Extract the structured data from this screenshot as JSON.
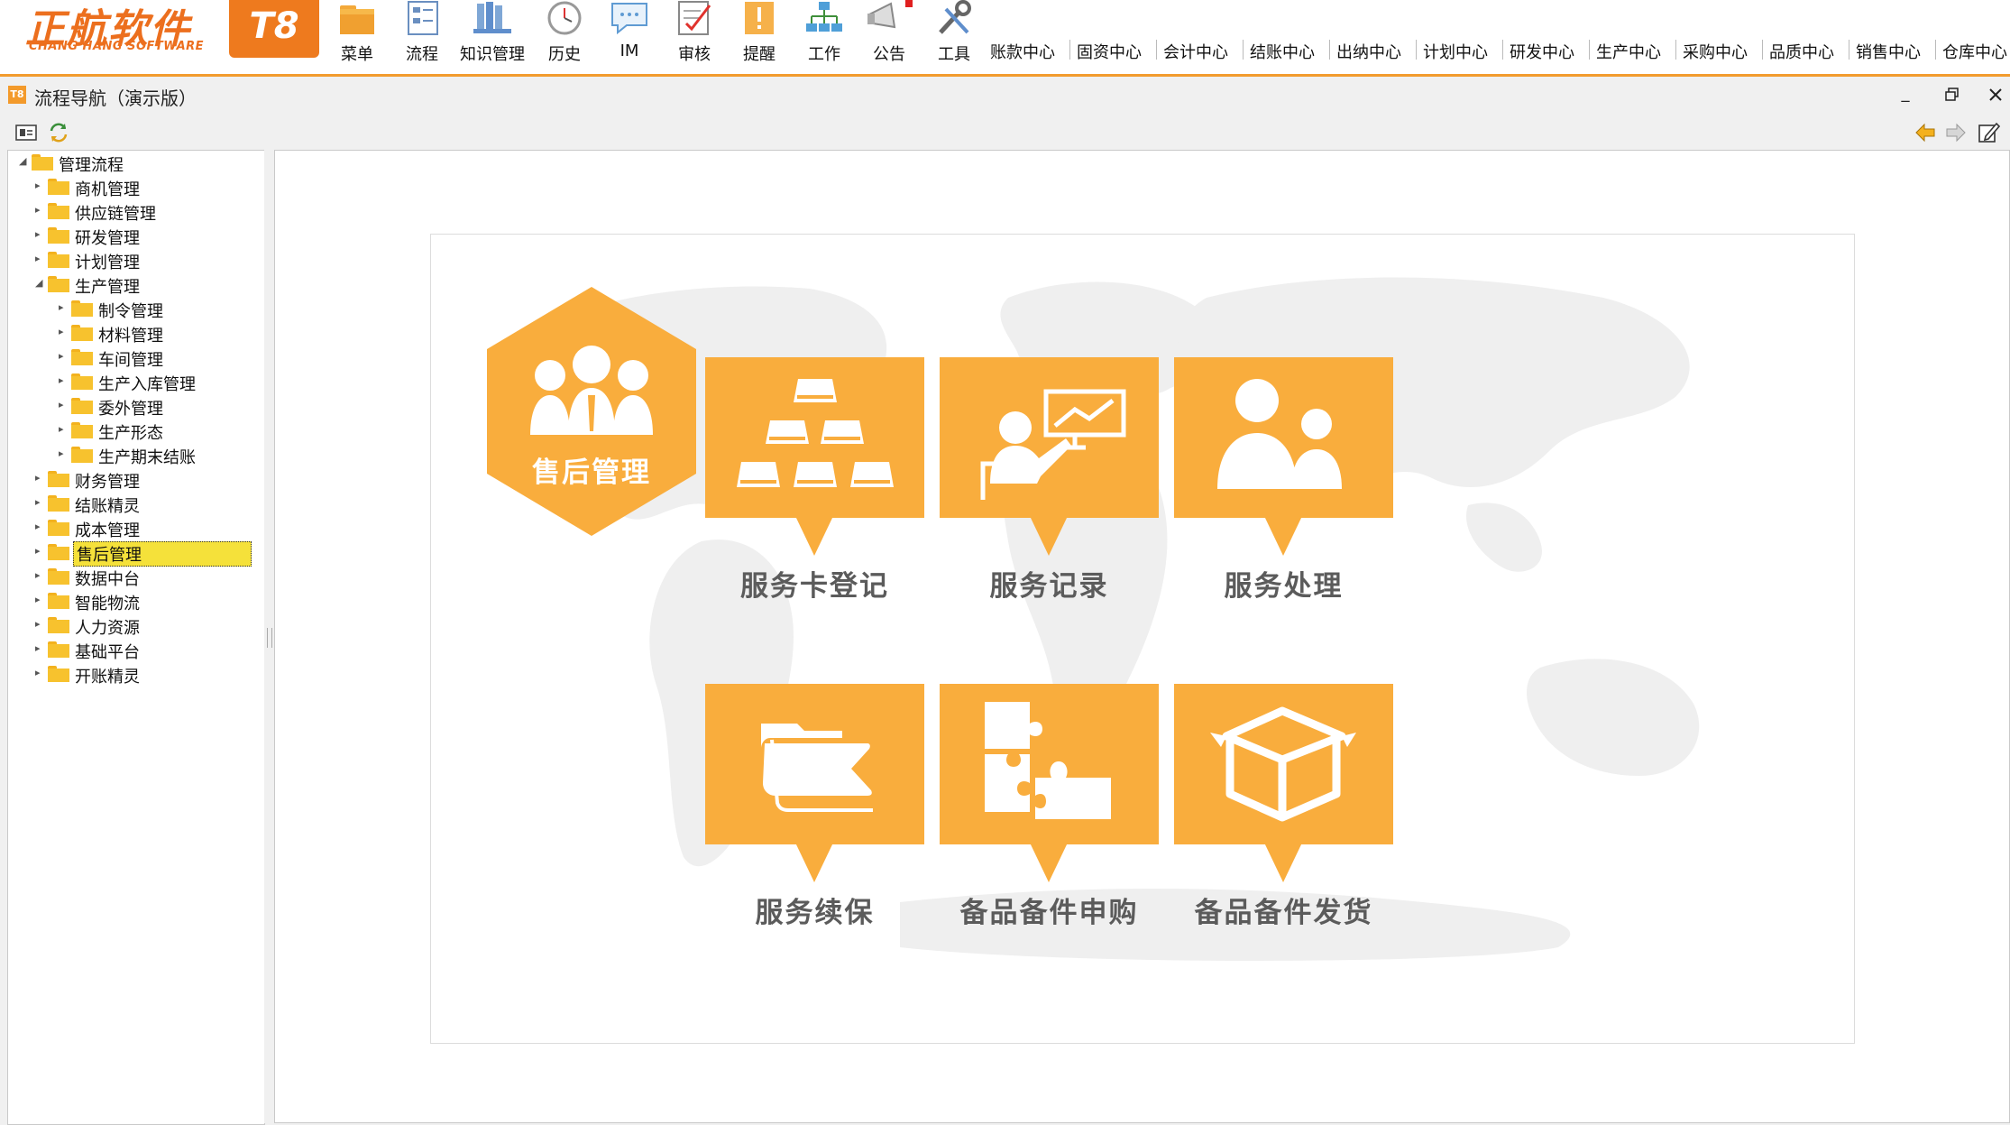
{
  "logo": {
    "name_cn": "正航软件",
    "name_en": "CHANG HANG SOFTWARE",
    "version": "T8"
  },
  "toolbar": {
    "tools": [
      {
        "label": "菜单",
        "icon": "menu-folder-icon"
      },
      {
        "label": "流程",
        "icon": "flow-icon"
      },
      {
        "label": "知识管理",
        "icon": "knowledge-books-icon"
      },
      {
        "label": "历史",
        "icon": "history-clock-icon"
      },
      {
        "label": "IM",
        "icon": "chat-bubble-icon"
      },
      {
        "label": "审核",
        "icon": "review-check-icon"
      },
      {
        "label": "提醒",
        "icon": "reminder-exclaim-icon"
      },
      {
        "label": "工作",
        "icon": "work-org-icon"
      },
      {
        "label": "公告",
        "icon": "announce-megaphone-icon"
      },
      {
        "label": "工具",
        "icon": "tools-wrench-icon"
      }
    ],
    "centers": [
      "账款中心",
      "固资中心",
      "会计中心",
      "结账中心",
      "出纳中心",
      "计划中心",
      "研发中心",
      "生产中心",
      "采购中心",
      "品质中心",
      "销售中心",
      "仓库中心"
    ]
  },
  "window": {
    "title": "流程导航（演示版）",
    "icon_text": "T8"
  },
  "tree": {
    "root": "管理流程",
    "items": [
      "商机管理",
      "供应链管理",
      "研发管理",
      "计划管理",
      "生产管理",
      "制令管理",
      "材料管理",
      "车间管理",
      "生产入库管理",
      "委外管理",
      "生产形态",
      "生产期末结账",
      "财务管理",
      "结账精灵",
      "成本管理",
      "售后管理",
      "数据中台",
      "智能物流",
      "人力资源",
      "基础平台",
      "开账精灵"
    ],
    "selected": "售后管理"
  },
  "flow": {
    "title": "售后管理",
    "accent": "#f9ad3d",
    "steps": [
      {
        "label": "服务卡登记",
        "icon": "gold-bars-icon"
      },
      {
        "label": "服务记录",
        "icon": "presentation-icon"
      },
      {
        "label": "服务处理",
        "icon": "people-icon"
      },
      {
        "label": "服务续保",
        "icon": "folder-open-icon"
      },
      {
        "label": "备品备件申购",
        "icon": "puzzle-icon"
      },
      {
        "label": "备品备件发货",
        "icon": "box-icon"
      }
    ]
  }
}
